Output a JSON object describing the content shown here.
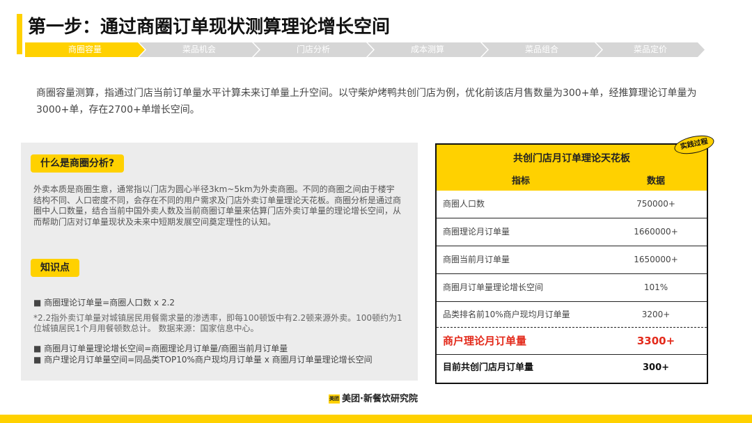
{
  "title": "第一步：通过商圈订单现状测算理论增长空间",
  "steps": [
    "商圈容量",
    "菜品机会",
    "门店分析",
    "成本测算",
    "菜品组合",
    "菜品定价"
  ],
  "intro": "商圈容量测算，指通过门店当前订单量水平计算未来订单量上升空间。以守柴炉烤鸭共创门店为例，优化前该店月售数量为300+单，经推算理论订单量为3000+单，存在2700+单增长空间。",
  "left": {
    "q1": "什么是商圈分析?",
    "p1": "外卖本质是商圈生意，通常指以门店为圆心半径3km~5km为外卖商圈。不同的商圈之间由于楼宇结构不同、人口密度不同，会存在不同的用户需求及门店外卖订单量理论天花板。商圈分析是通过商圈中人口数量，结合当前中国外卖人数及当前商圈订单量来估算门店外卖订单量的理论增长空间，从而帮助门店对订单量现状及未来中短期发展空间奠定理性的认知。",
    "q2": "知识点",
    "b1": "■ 商圈理论订单量=商圈人口数 x 2.2",
    "note": "*2.2指外卖订单量对城镇居民用餐需求量的渗透率，即每100顿饭中有2.2顿来源外卖。100顿约为1位城镇居民1个月用餐顿数总计。      数据来源：国家信息中心。",
    "b2": "■ 商圈月订单量理论增长空间=商圈理论月订单量/商圈当前月订单量",
    "b3": "■ 商户理论月订单量空间=同品类TOP10%商户现均月订单量 x 商圈月订单量理论增长空间"
  },
  "table": {
    "stamp": "实践过程",
    "title": "共创门店月订单理论天花板",
    "col1": "指标",
    "col2": "数据",
    "rows": [
      {
        "k": "商圈人口数",
        "v": "750000+"
      },
      {
        "k": "商圈理论月订单量",
        "v": "1660000+"
      },
      {
        "k": "商圈当前月订单量",
        "v": "1650000+"
      },
      {
        "k": "商圈月订单量理论增长空间",
        "v": "101%"
      },
      {
        "k": "品类排名前10%商户现均月订单量",
        "v": "3200+"
      },
      {
        "k": "商户理论月订单量",
        "v": "3300+"
      },
      {
        "k": "目前共创门店月订单量",
        "v": "300+"
      }
    ]
  },
  "footer": {
    "logo_mark": "美团",
    "brand": "美团·新餐饮研究院"
  }
}
